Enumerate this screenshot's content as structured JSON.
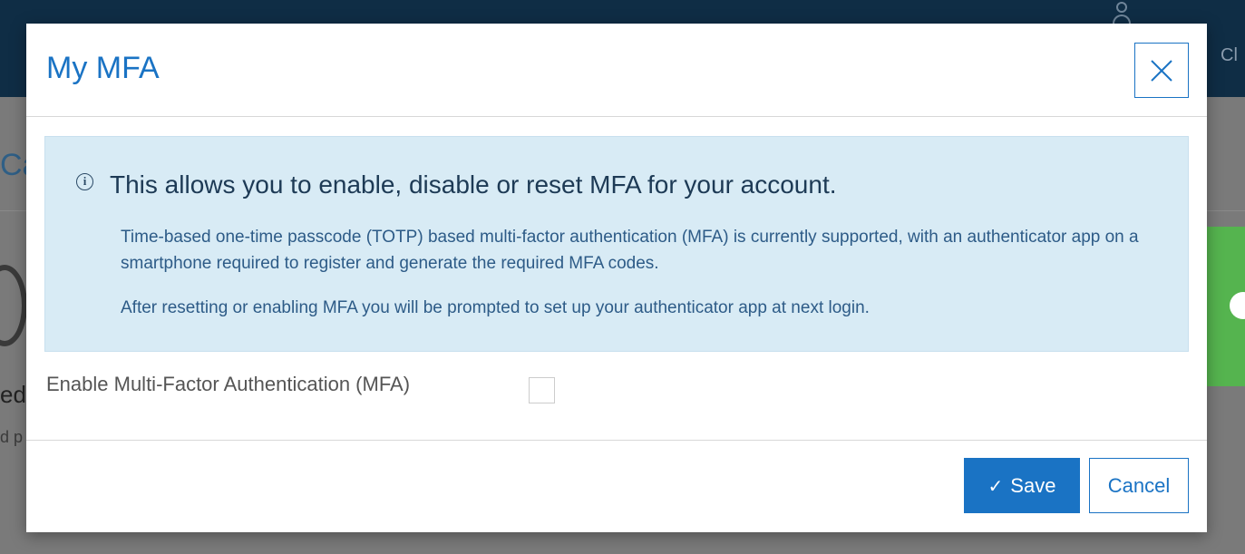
{
  "background": {
    "topbar_text": "Cl",
    "title_fragment": "Ca",
    "text_fragment_1": "ed",
    "text_fragment_2": "d p"
  },
  "modal": {
    "title": "My MFA",
    "close_icon": "close-icon",
    "info": {
      "icon": "info-circle-icon",
      "title": "This allows you to enable, disable or reset MFA for your account.",
      "paragraph1": "Time-based one-time passcode (TOTP) based multi-factor authentication (MFA) is currently supported, with an authenticator app on a smartphone required to register and generate the required MFA codes.",
      "paragraph2": "After resetting or enabling MFA you will be prompted to set up your authenticator app at next login."
    },
    "mfa_toggle": {
      "label": "Enable Multi-Factor Authentication (MFA)",
      "checked": false
    },
    "footer": {
      "save_icon": "✓",
      "save_label": "Save",
      "cancel_label": "Cancel"
    }
  },
  "colors": {
    "accent": "#1a73c4",
    "topbar": "#0f2d45",
    "info_background": "#d8ebf5",
    "success": "#55b44f"
  }
}
